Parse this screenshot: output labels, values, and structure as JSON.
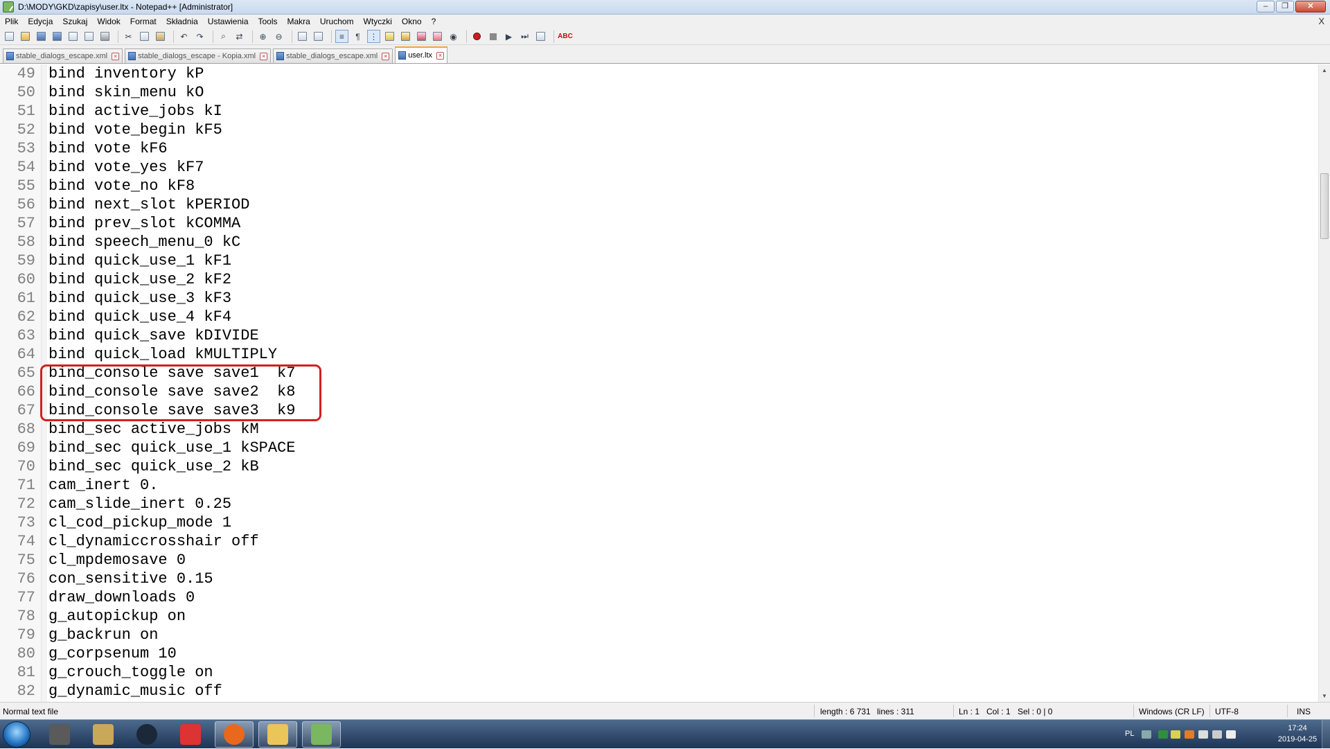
{
  "window": {
    "title": "D:\\MODY\\GKD\\zapisy\\user.ltx - Notepad++ [Administrator]",
    "minimize": "‒",
    "restore": "❐",
    "close": "✕"
  },
  "menu": {
    "items": [
      "Plik",
      "Edycja",
      "Szukaj",
      "Widok",
      "Format",
      "Składnia",
      "Ustawienia",
      "Tools",
      "Makra",
      "Uruchom",
      "Wtyczki",
      "Okno",
      "?"
    ],
    "close_doc": "X"
  },
  "toolbar": {
    "spellcheck_label": "ABC"
  },
  "tabs": [
    {
      "label": "stable_dialogs_escape.xml",
      "active": false
    },
    {
      "label": "stable_dialogs_escape - Kopia.xml",
      "active": false
    },
    {
      "label": "stable_dialogs_escape.xml",
      "active": false
    },
    {
      "label": "user.ltx",
      "active": true
    }
  ],
  "editor": {
    "lines": [
      {
        "n": "49",
        "text": "bind inventory kP"
      },
      {
        "n": "50",
        "text": "bind skin_menu kO"
      },
      {
        "n": "51",
        "text": "bind active_jobs kI"
      },
      {
        "n": "52",
        "text": "bind vote_begin kF5"
      },
      {
        "n": "53",
        "text": "bind vote kF6"
      },
      {
        "n": "54",
        "text": "bind vote_yes kF7"
      },
      {
        "n": "55",
        "text": "bind vote_no kF8"
      },
      {
        "n": "56",
        "text": "bind next_slot kPERIOD"
      },
      {
        "n": "57",
        "text": "bind prev_slot kCOMMA"
      },
      {
        "n": "58",
        "text": "bind speech_menu_0 kC"
      },
      {
        "n": "59",
        "text": "bind quick_use_1 kF1"
      },
      {
        "n": "60",
        "text": "bind quick_use_2 kF2"
      },
      {
        "n": "61",
        "text": "bind quick_use_3 kF3"
      },
      {
        "n": "62",
        "text": "bind quick_use_4 kF4"
      },
      {
        "n": "63",
        "text": "bind quick_save kDIVIDE"
      },
      {
        "n": "64",
        "text": "bind quick_load kMULTIPLY"
      },
      {
        "n": "65",
        "text": "bind_console save save1  k7"
      },
      {
        "n": "66",
        "text": "bind_console save save2  k8"
      },
      {
        "n": "67",
        "text": "bind_console save save3  k9"
      },
      {
        "n": "68",
        "text": "bind_sec active_jobs kM"
      },
      {
        "n": "69",
        "text": "bind_sec quick_use_1 kSPACE"
      },
      {
        "n": "70",
        "text": "bind_sec quick_use_2 kB"
      },
      {
        "n": "71",
        "text": "cam_inert 0."
      },
      {
        "n": "72",
        "text": "cam_slide_inert 0.25"
      },
      {
        "n": "73",
        "text": "cl_cod_pickup_mode 1"
      },
      {
        "n": "74",
        "text": "cl_dynamiccrosshair off"
      },
      {
        "n": "75",
        "text": "cl_mpdemosave 0"
      },
      {
        "n": "76",
        "text": "con_sensitive 0.15"
      },
      {
        "n": "77",
        "text": "draw_downloads 0"
      },
      {
        "n": "78",
        "text": "g_autopickup on"
      },
      {
        "n": "79",
        "text": "g_backrun on"
      },
      {
        "n": "80",
        "text": "g_corpsenum 10"
      },
      {
        "n": "81",
        "text": "g_crouch_toggle on"
      },
      {
        "n": "82",
        "text": "g_dynamic_music off"
      }
    ]
  },
  "status": {
    "file_type": "Normal text file",
    "length": "length : 6 731",
    "lines": "lines : 311",
    "ln": "Ln : 1",
    "col": "Col : 1",
    "sel": "Sel : 0 | 0",
    "eol": "Windows (CR LF)",
    "encoding": "UTF-8",
    "mode": "INS"
  },
  "taskbar": {
    "lang": "PL",
    "time": "17:24",
    "date": "2019-04-25",
    "apps": [
      {
        "name": "steam-app-icon-1",
        "color": "#5a5a5a"
      },
      {
        "name": "archive-app-icon",
        "color": "#c9a85a"
      },
      {
        "name": "steam-icon",
        "color": "#1b2838"
      },
      {
        "name": "ccleaner-icon",
        "color": "#d33"
      },
      {
        "name": "firefox-icon",
        "color": "#e8681e"
      },
      {
        "name": "explorer-folder-icon",
        "color": "#e9c55a"
      },
      {
        "name": "notepadpp-icon",
        "color": "#7bb661"
      }
    ]
  },
  "colors": {
    "highlight_border": "#d22020",
    "active_tab_accent": "#f3a33b"
  }
}
